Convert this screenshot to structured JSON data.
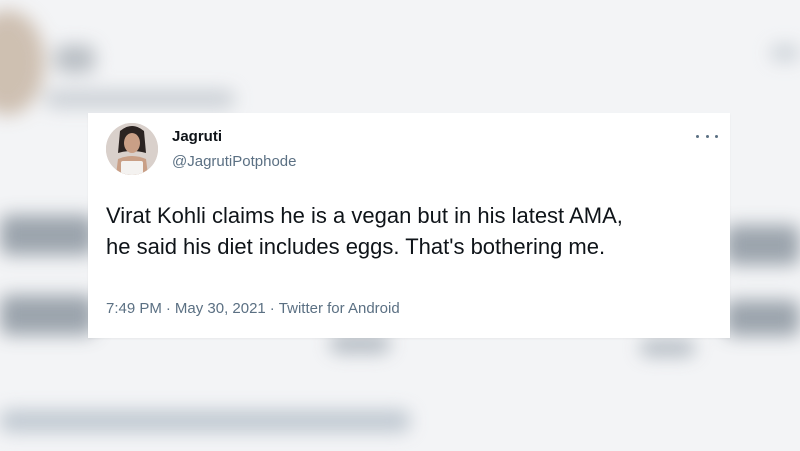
{
  "tweet": {
    "author_name": "Jagruti",
    "author_handle": "@JagrutiPotphode",
    "text": "Virat Kohli claims he is a vegan but in his latest AMA,\nhe said his diet includes eggs. That's bothering me.",
    "time": "7:49 PM",
    "date": "May 30, 2021",
    "source": "Twitter for Android",
    "separator": "·",
    "more_icon": "more-horizontal-icon"
  },
  "colors": {
    "text_primary": "#0f1419",
    "text_secondary": "#5b7083",
    "card_background": "#ffffff"
  }
}
